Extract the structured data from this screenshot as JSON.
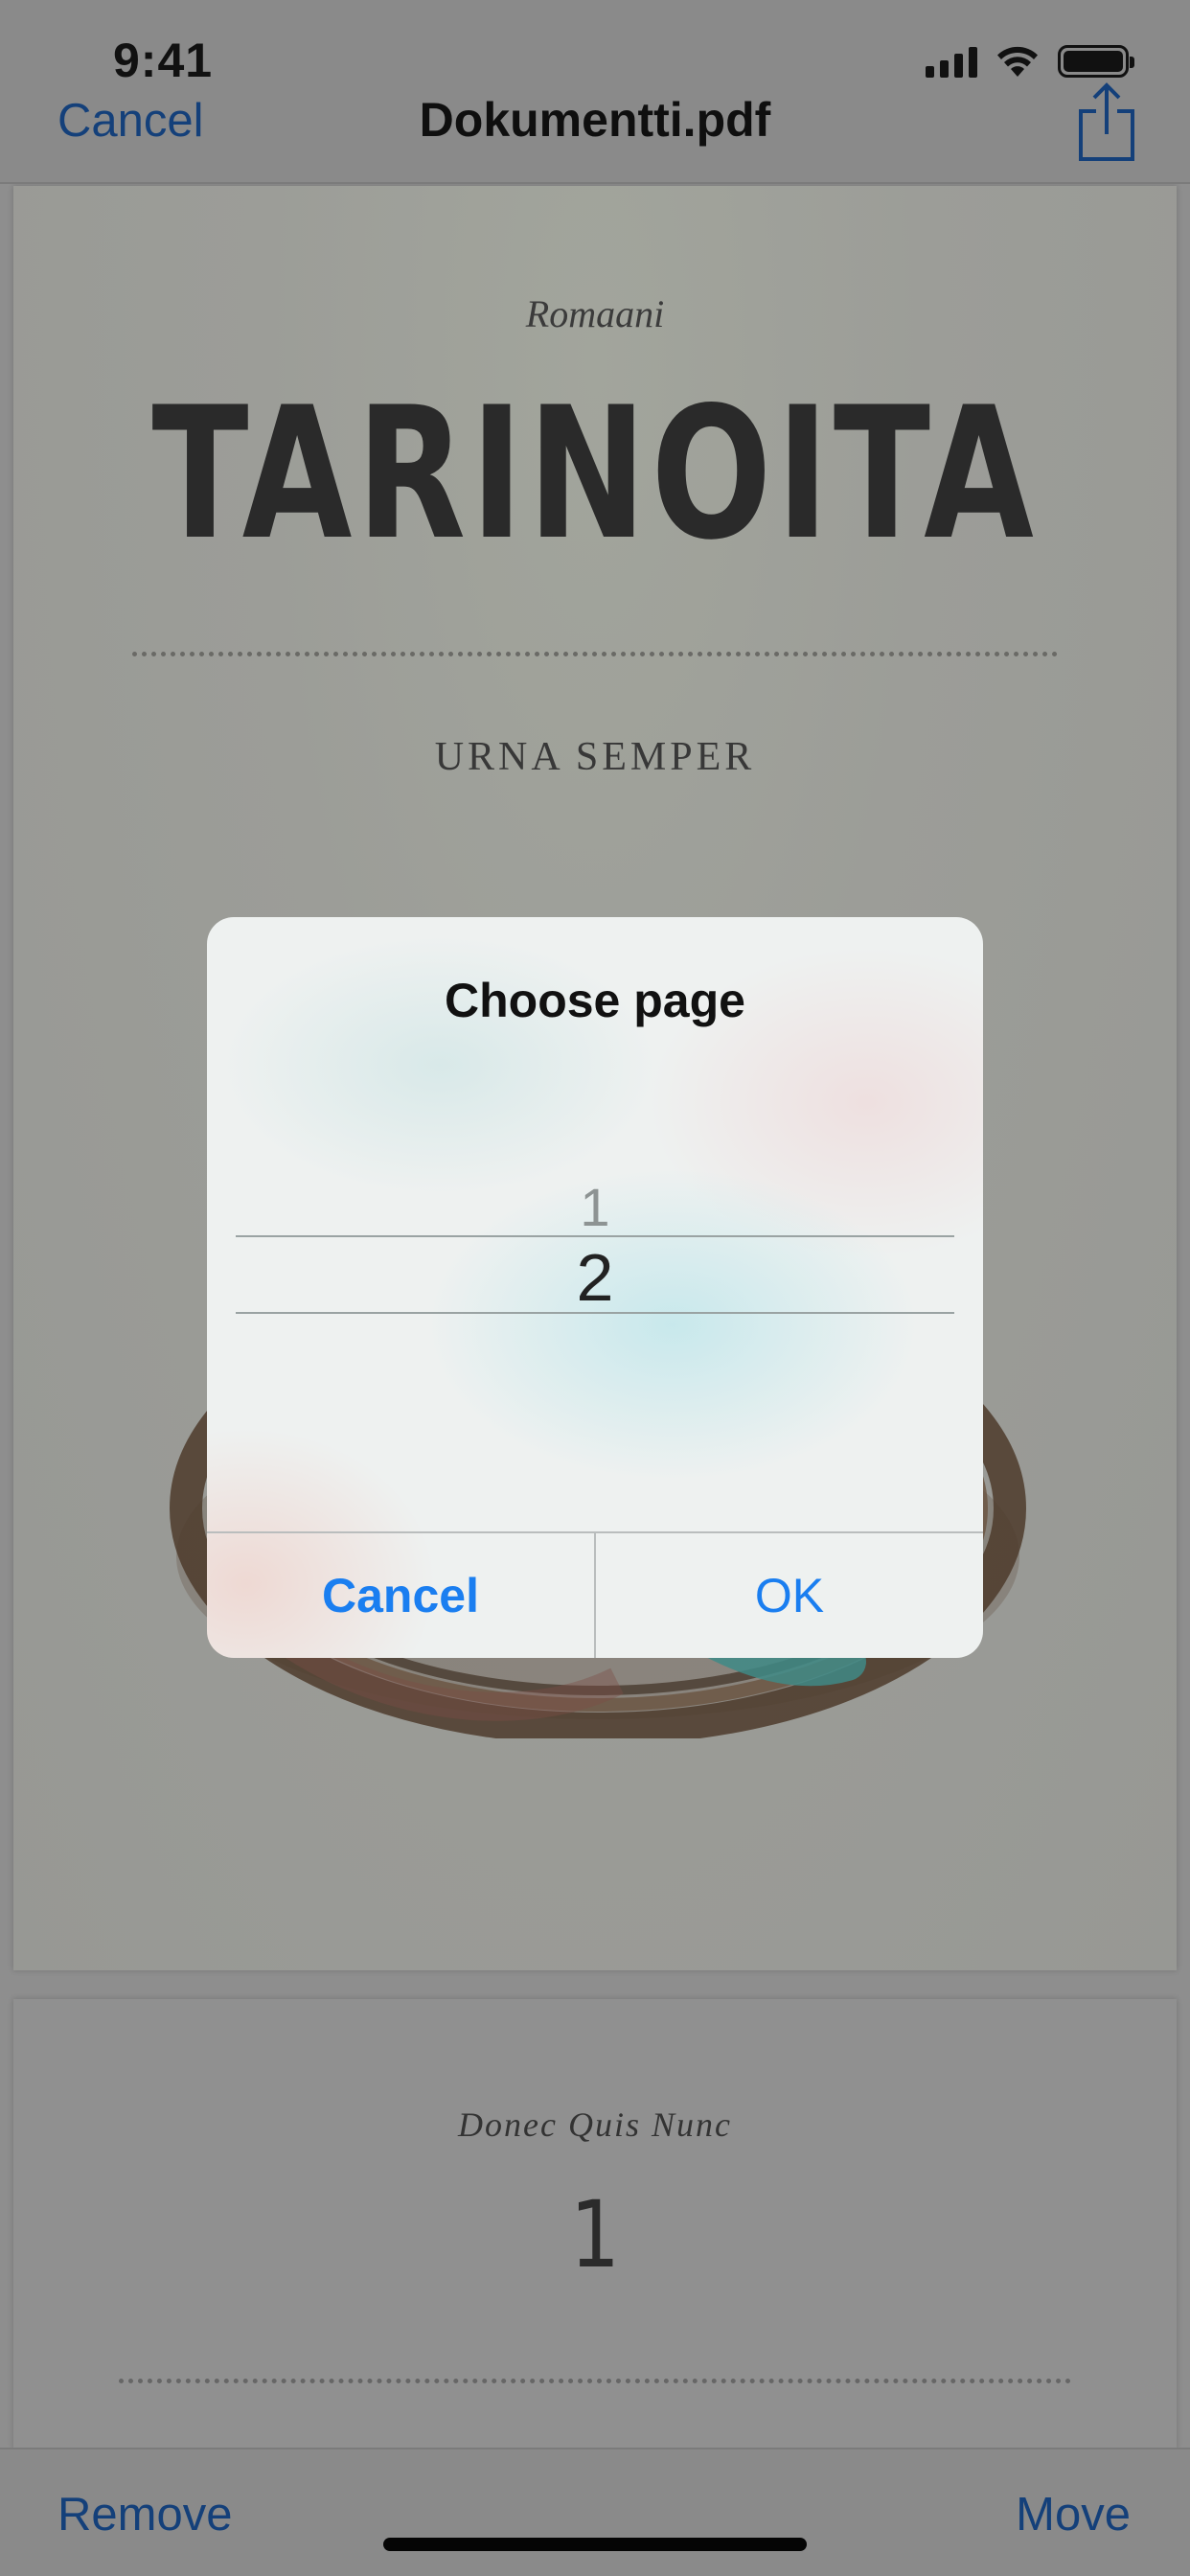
{
  "status_bar": {
    "time": "9:41"
  },
  "nav": {
    "cancel_label": "Cancel",
    "title": "Dokumentti.pdf",
    "share_icon": "share-icon"
  },
  "document": {
    "page1": {
      "subtitle": "Romaani",
      "title": "TARINOITA",
      "author": "URNA SEMPER"
    },
    "page2": {
      "subtitle": "Donec Quis Nunc",
      "number": "1"
    }
  },
  "dialog": {
    "title": "Choose page",
    "picker_options": [
      "1",
      "2"
    ],
    "picker_previous": "1",
    "picker_selected": "2",
    "cancel_label": "Cancel",
    "ok_label": "OK"
  },
  "toolbar": {
    "remove_label": "Remove",
    "move_label": "Move"
  },
  "colors": {
    "accent": "#1a7ef0",
    "dimmed_accent": "#14407a"
  }
}
